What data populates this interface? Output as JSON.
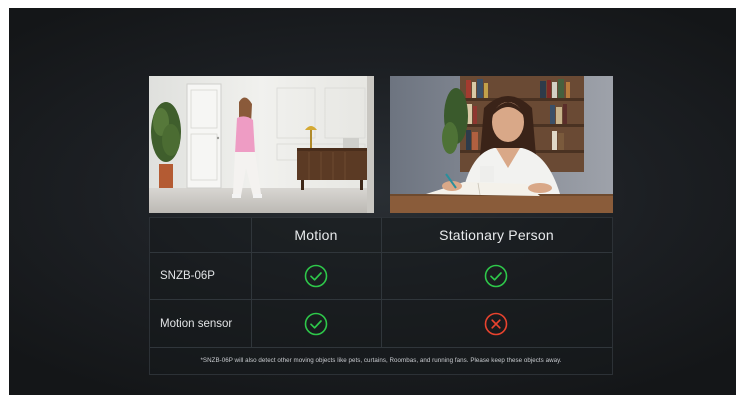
{
  "images": {
    "left_alt": "woman walking through a room",
    "right_alt": "woman writing at a desk"
  },
  "table": {
    "corner": "",
    "columns": [
      "Motion",
      "Stationary Person"
    ],
    "rows": [
      {
        "label": "SNZB-06P",
        "motion": "check",
        "stationary": "check"
      },
      {
        "label": "Motion sensor",
        "motion": "check",
        "stationary": "cross"
      }
    ],
    "footnote": "*SNZB-06P will also detect other moving objects like pets, curtains, Roombas, and running fans. Please keep these objects away."
  },
  "colors": {
    "check": "#2ec84a",
    "cross": "#e8432e",
    "background": "#1c1f23"
  },
  "icons": {
    "check": "check-circle-icon",
    "cross": "x-circle-icon"
  }
}
